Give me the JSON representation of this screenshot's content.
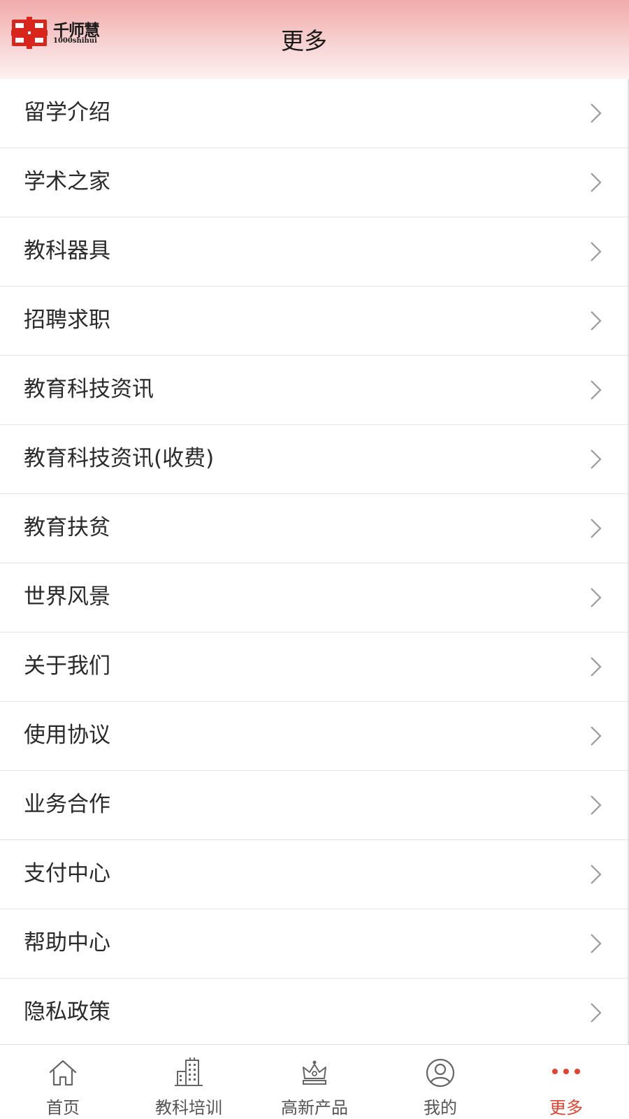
{
  "header": {
    "title": "更多",
    "logo_cn": "千师慧",
    "logo_en": "1000shihui"
  },
  "menu": {
    "items": [
      {
        "label": "留学介绍"
      },
      {
        "label": "学术之家"
      },
      {
        "label": "教科器具"
      },
      {
        "label": "招聘求职"
      },
      {
        "label": "教育科技资讯"
      },
      {
        "label": "教育科技资讯(收费)"
      },
      {
        "label": "教育扶贫"
      },
      {
        "label": "世界风景"
      },
      {
        "label": "关于我们"
      },
      {
        "label": "使用协议"
      },
      {
        "label": "业务合作"
      },
      {
        "label": "支付中心"
      },
      {
        "label": "帮助中心"
      },
      {
        "label": "隐私政策"
      }
    ]
  },
  "tabbar": {
    "tabs": [
      {
        "label": "首页",
        "icon": "home-icon"
      },
      {
        "label": "教科培训",
        "icon": "building-icon"
      },
      {
        "label": "高新产品",
        "icon": "crown-icon"
      },
      {
        "label": "我的",
        "icon": "user-icon"
      },
      {
        "label": "更多",
        "icon": "more-icon",
        "active": true
      }
    ]
  },
  "colors": {
    "header_top": "#f2aaaa",
    "accent": "#e8422f",
    "logo_red": "#d9261c"
  }
}
